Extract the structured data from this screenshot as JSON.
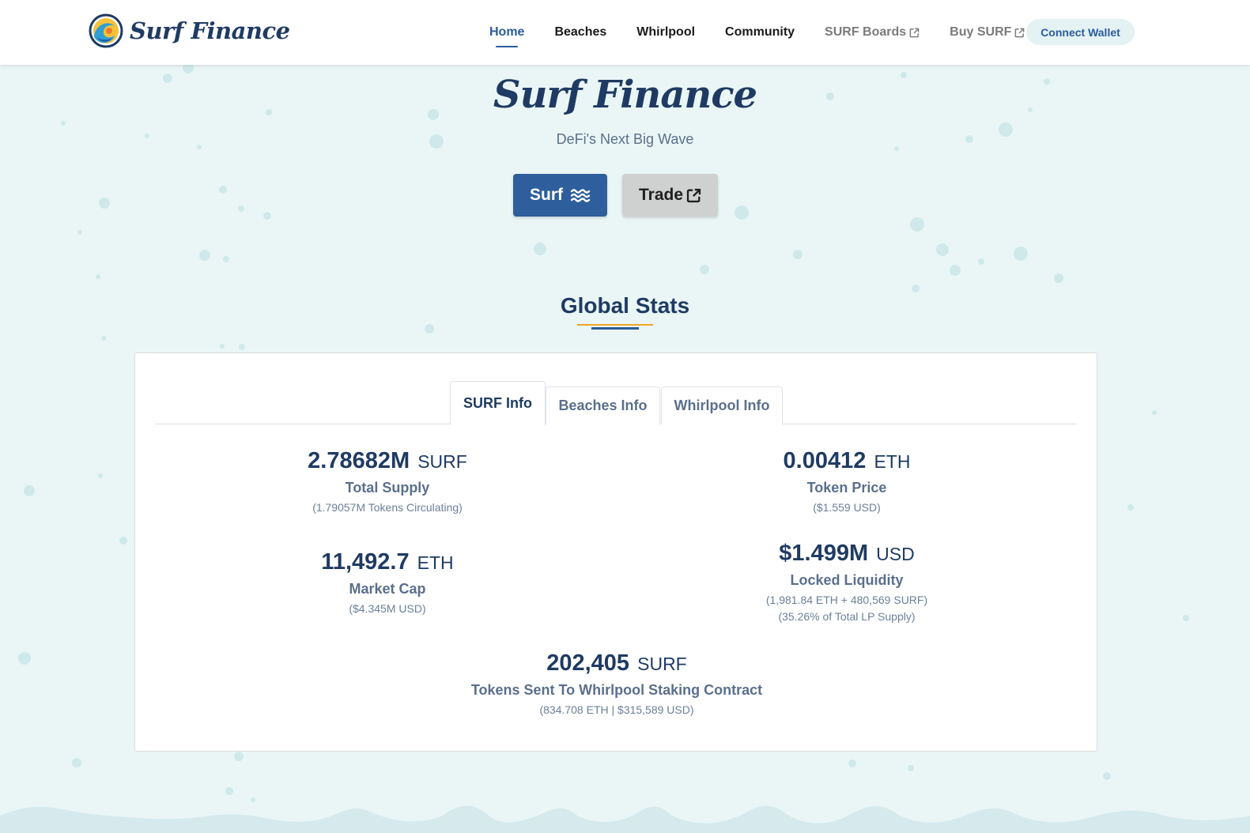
{
  "nav": {
    "brand": "Surf Finance",
    "items": [
      {
        "label": "Home",
        "active": true,
        "external": false
      },
      {
        "label": "Beaches",
        "active": false,
        "external": false
      },
      {
        "label": "Whirlpool",
        "active": false,
        "external": false
      },
      {
        "label": "Community",
        "active": false,
        "external": false
      },
      {
        "label": "SURF Boards",
        "active": false,
        "external": true
      },
      {
        "label": "Buy SURF",
        "active": false,
        "external": true
      }
    ],
    "connect_label": "Connect Wallet",
    "icons": {
      "logo": "surf-wave-logo-icon",
      "external": "external-link-icon"
    }
  },
  "hero": {
    "title": "Surf Finance",
    "subtitle": "DeFi's Next Big Wave",
    "surf_label": "Surf",
    "surf_icon": "water-waves-icon",
    "trade_label": "Trade",
    "trade_icon": "external-link-icon"
  },
  "stats": {
    "title": "Global Stats",
    "tabs": [
      {
        "label": "SURF Info",
        "active": true
      },
      {
        "label": "Beaches Info",
        "active": false
      },
      {
        "label": "Whirlpool Info",
        "active": false
      }
    ],
    "items": {
      "total_supply": {
        "value": "2.78682M",
        "unit": "SURF",
        "label": "Total Supply",
        "notes": [
          "(1.79057M Tokens Circulating)"
        ]
      },
      "token_price": {
        "value": "0.00412",
        "unit": "ETH",
        "label": "Token Price",
        "notes": [
          "($1.559 USD)"
        ]
      },
      "market_cap": {
        "value": "11,492.7",
        "unit": "ETH",
        "label": "Market Cap",
        "notes": [
          "($4.345M USD)"
        ]
      },
      "locked_liquidity": {
        "value": "$1.499M",
        "unit": "USD",
        "label": "Locked Liquidity",
        "notes": [
          "(1,981.84 ETH + 480,569 SURF)",
          "(35.26% of Total LP Supply)"
        ]
      },
      "whirlpool_sent": {
        "value": "202,405",
        "unit": "SURF",
        "label": "Tokens Sent To Whirlpool Staking Contract",
        "notes": [
          "(834.708 ETH | $315,589 USD)"
        ]
      }
    }
  },
  "colors": {
    "primary": "#2e5f9c",
    "navy": "#1f3b63",
    "background": "#eaf6f6",
    "accent": "#f0a526",
    "muted_text": "#5b6f8c",
    "trade_button": "#cfd0d0",
    "connect_button": "#e4f2f4"
  }
}
